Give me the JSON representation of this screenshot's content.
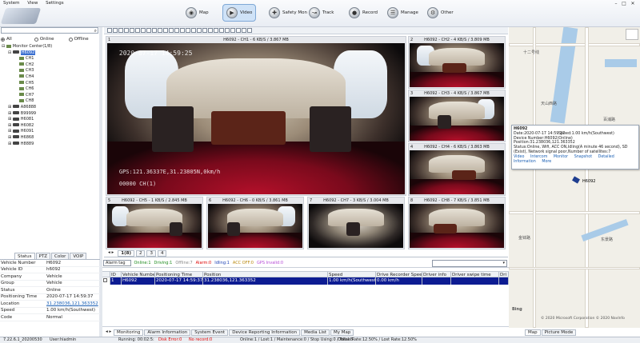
{
  "menu": [
    "System",
    "View",
    "Settings"
  ],
  "nav": [
    {
      "label": "Map",
      "icon": "map-icon",
      "active": false
    },
    {
      "label": "Video",
      "icon": "video-icon",
      "active": true
    },
    {
      "label": "Safety Mon",
      "icon": "safety-icon",
      "active": false
    },
    {
      "label": "Track",
      "icon": "track-icon",
      "active": false
    },
    {
      "label": "Record",
      "icon": "record-icon",
      "active": false
    },
    {
      "label": "Manage",
      "icon": "manage-icon",
      "active": false
    },
    {
      "label": "Other",
      "icon": "other-icon",
      "active": false
    }
  ],
  "filters": {
    "all": "All",
    "online": "Online",
    "offline": "Offline"
  },
  "tree": {
    "root": "Monitor Center(1/8)",
    "selected_device": "H6092",
    "channels": [
      "CH1",
      "CH2",
      "CH3",
      "CH4",
      "CH5",
      "CH6",
      "CH7",
      "CH8"
    ],
    "devices": [
      "A86888",
      "B99999",
      "H6081",
      "H6082",
      "H6091",
      "H6868",
      "H8889"
    ]
  },
  "left_tabs": [
    "Status",
    "PTZ",
    "Color",
    "VOIP"
  ],
  "props": [
    {
      "k": "Vehicle Number",
      "v": "H6092"
    },
    {
      "k": "Vehicle ID",
      "v": "h6092"
    },
    {
      "k": "Company",
      "v": "Vehicle"
    },
    {
      "k": "Group",
      "v": "Vehicle"
    },
    {
      "k": "Status",
      "v": "Online"
    },
    {
      "k": "Positioning Time",
      "v": "2020-07-17 14:59:37"
    },
    {
      "k": "Location",
      "v": "31.238036,121.363352"
    },
    {
      "k": "Speed",
      "v": "1.00 km/h(Southwest)"
    },
    {
      "k": "Code",
      "v": "Normal"
    }
  ],
  "panes": [
    {
      "num": "1",
      "title": "H6092 - CH1 - 6 KB/S / 3.867 MB",
      "overlay": "2020-07-17 14:59:25",
      "overlay2": "GPS:121.36337E,31.23805N,0km/h",
      "overlay3": "00000  CH(1)"
    },
    {
      "num": "2",
      "title": "H6092 - CH2 - 4 KB/S / 3.809 MB"
    },
    {
      "num": "3",
      "title": "H6092 - CH3 - 4 KB/S / 3.867 MB"
    },
    {
      "num": "4",
      "title": "H6092 - CH4 - 6 KB/S / 3.863 MB"
    },
    {
      "num": "5",
      "title": "H6092 - CH5 - 1 KB/S / 2.845 MB"
    },
    {
      "num": "6",
      "title": "H6092 - CH6 - 0 KB/S / 3.861 MB"
    },
    {
      "num": "7",
      "title": "H6092 - CH7 - 3 KB/S / 3.004 MB"
    },
    {
      "num": "8",
      "title": "H6092 - CH8 - 7 KB/S / 3.851 MB"
    }
  ],
  "page_tabs": [
    "1(8)",
    "2",
    "3",
    "4"
  ],
  "legend": {
    "alarm_tag": "Alarm tag",
    "online": "Online:1",
    "driving": "Driving:1",
    "offline": "Offline:7",
    "alarm": "Alarm:0",
    "idling": "Idling:1",
    "acc_off": "ACC OFF:0",
    "gps_invalid": "GPS Invalid:0"
  },
  "table": {
    "headers": [
      "ID",
      "Vehicle Number",
      "Positioning Time",
      "Position",
      "Speed",
      "Drive Recorder Speed",
      "Driver info",
      "Driver swipe time",
      "Dri"
    ],
    "rows": [
      [
        "1",
        "H6092",
        "2020-07-17 14:59:37",
        "31.238036,121.363352",
        "1.00 km/h(Southwest)",
        "0.00 km/h",
        "",
        "",
        ""
      ]
    ]
  },
  "bottom_tabs": [
    "Monitoring",
    "Alarm Information",
    "System Event",
    "Device Reporting Information",
    "Media List",
    "My Map"
  ],
  "map": {
    "labels": [
      "十二号线",
      "天山西路",
      "百浦路",
      "金钵路",
      "东景路",
      "H6092"
    ],
    "copyright": "© 2020 Microsoft Corporation © 2020 NavInfo",
    "bing": "Bing",
    "tabs": [
      "Map",
      "Picture Mode"
    ]
  },
  "popup": {
    "title": "H6092",
    "date": "Date:2020-07-17 14:59:37",
    "speed": "Speed:1.00 km/h(Southwest)",
    "device": "Device Number:H6092(Online)",
    "position": "Position:31.238036,121.363352",
    "status": "Status:Online, Wifi, ACC ON,Idling(A minute 46 second), SD (Exist), Network signal poor,Number of satellites:7",
    "links": [
      "Video",
      "Intercom",
      "Monitor",
      "Snapshot",
      "Detailed",
      "Information",
      "More"
    ]
  },
  "status": {
    "version": "7.22.6.1_20200530",
    "user": "User:hiadmin",
    "running": "Running: 00:02:5:",
    "disk_error": "Disk Error:0",
    "no_record": "No record:0",
    "counts": "Online:1 / Lost:1 / Maintenance:0 / Stop Using:0 / Total:8",
    "rate": "Online Rate:12.50% / Lost Rate:12.50%"
  }
}
